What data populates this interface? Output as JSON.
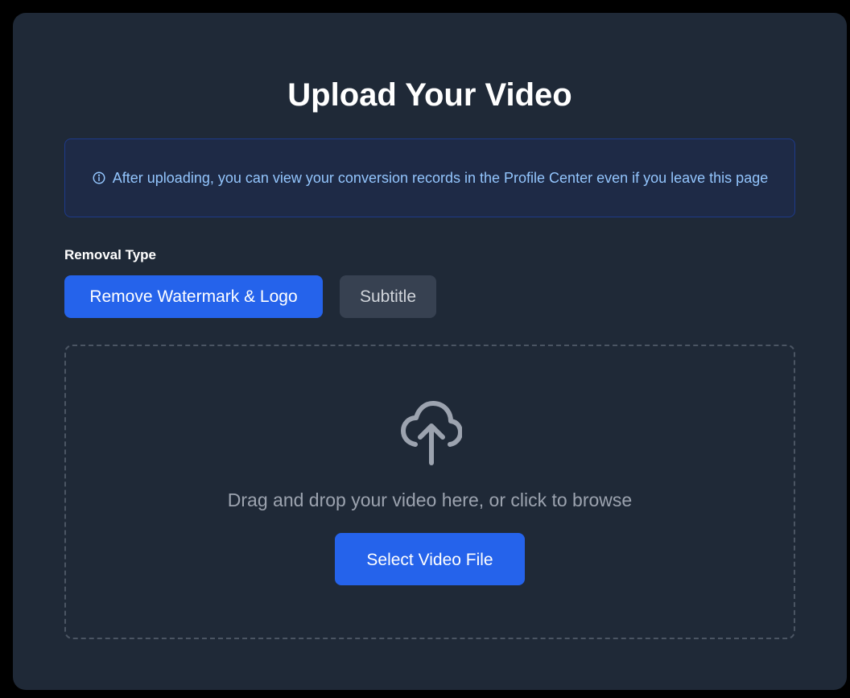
{
  "upload": {
    "title": "Upload Your Video",
    "info_message": "After uploading, you can view your conversion records in the Profile Center even if you leave this page",
    "removal_type": {
      "label": "Removal Type",
      "options": [
        "Remove Watermark & Logo",
        "Subtitle"
      ],
      "selected": "Remove Watermark & Logo"
    },
    "dropzone": {
      "text": "Drag and drop your video here, or click to browse",
      "icon": "cloud-upload-icon",
      "button_label": "Select Video File"
    }
  },
  "colors": {
    "page_background": "#000000",
    "card_background": "#1f2937",
    "accent": "#2563eb",
    "info_text": "#93c5fd",
    "info_background": "#1e2a46",
    "inactive_button": "#374151",
    "muted_text": "#9ca3af"
  }
}
